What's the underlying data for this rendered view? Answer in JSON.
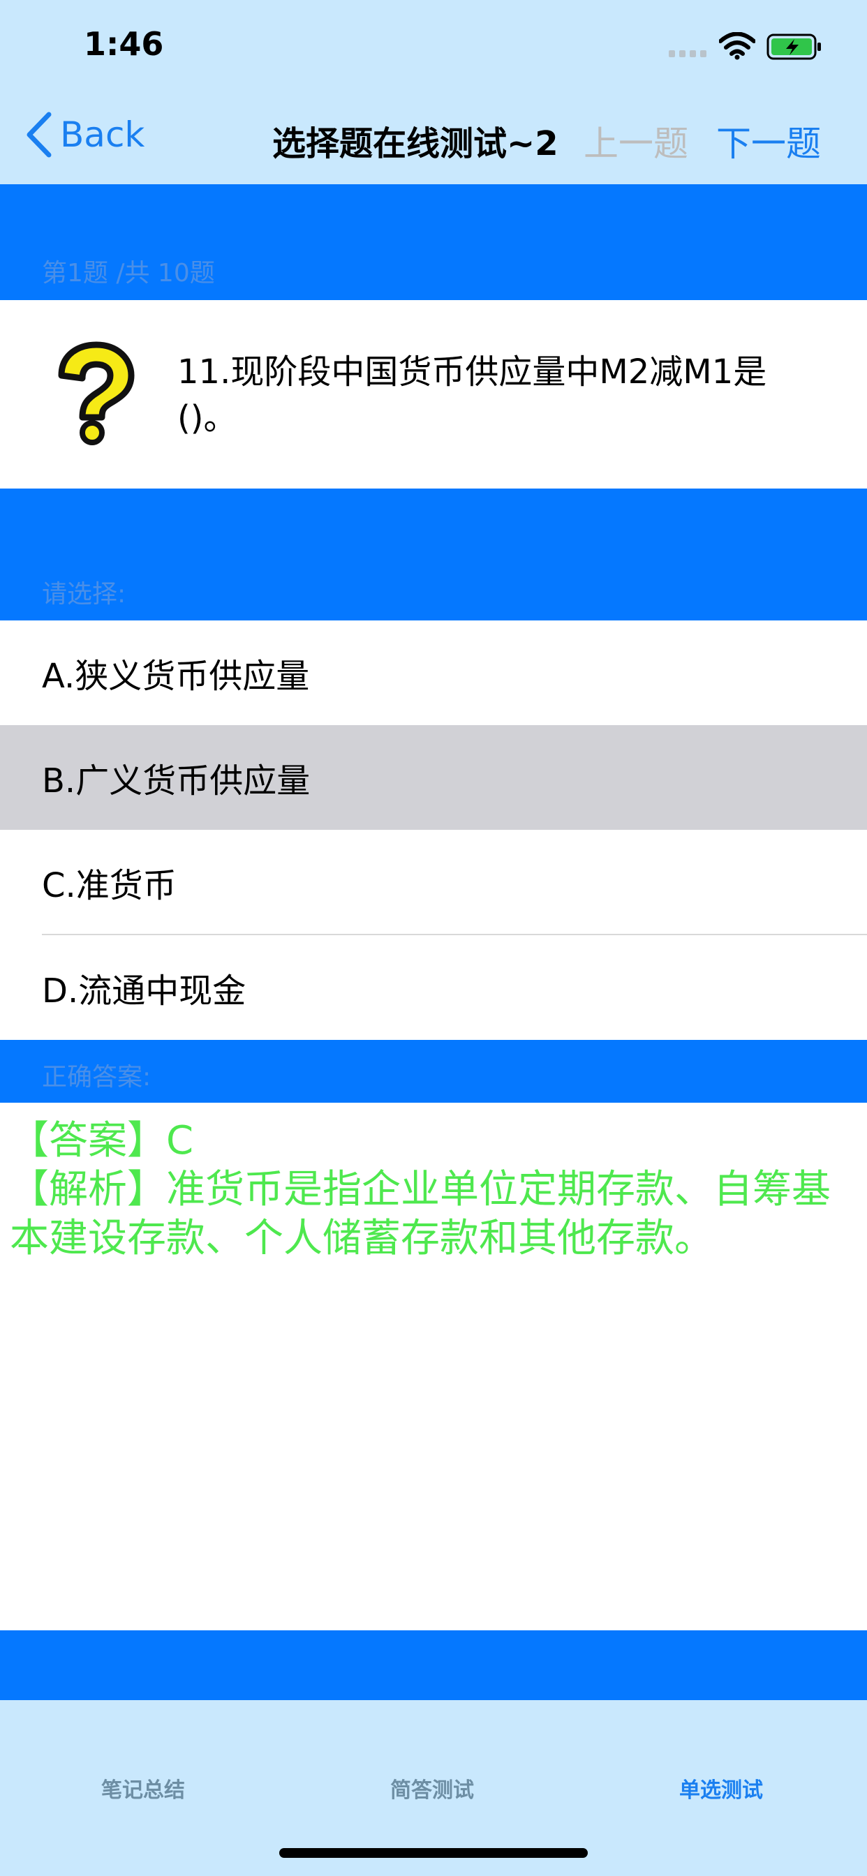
{
  "status_bar": {
    "time": "1:46"
  },
  "nav": {
    "back_label": "Back",
    "title": "选择题在线测试~2",
    "prev_label": "上一题",
    "next_label": "下一题"
  },
  "progress_label": "第1题 /共 10题",
  "question": {
    "text": "11.现阶段中国货币供应量中M2减M1是()。",
    "icon": "question-mark-icon"
  },
  "choose_label": "请选择:",
  "options": [
    {
      "label": "A.狭义货币供应量",
      "selected": false
    },
    {
      "label": "B.广义货币供应量",
      "selected": true
    },
    {
      "label": "C.准货币",
      "selected": false
    },
    {
      "label": "D.流通中现金",
      "selected": false
    }
  ],
  "answer_label": "正确答案:",
  "answer": {
    "line1": "【答案】C",
    "line2": "【解析】准货币是指企业单位定期存款、自筹基本建设存款、个人储蓄存款和其他存款。"
  },
  "tabs": [
    {
      "label": "笔记总结",
      "active": false
    },
    {
      "label": "简答测试",
      "active": false
    },
    {
      "label": "单选测试",
      "active": true
    }
  ],
  "colors": {
    "bar_background": "#c9e8fd",
    "section_blue": "#0578ff",
    "accent": "#1a7ff0",
    "answer_green": "#4ee84e",
    "selected_row": "#d1d1d6"
  }
}
